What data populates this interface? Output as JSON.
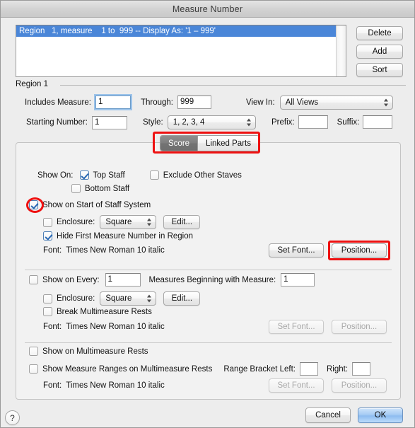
{
  "window": {
    "title": "Measure Number"
  },
  "region_list": {
    "items": [
      "Region   1, measure    1 to  999 -- Display As: '1 – 999'"
    ],
    "buttons": {
      "delete": "Delete",
      "add": "Add",
      "sort": "Sort"
    }
  },
  "region_section": {
    "label": "Region 1",
    "includes_measure_label": "Includes Measure:",
    "includes_measure_value": "1",
    "through_label": "Through:",
    "through_value": "999",
    "view_in_label": "View In:",
    "view_in_value": "All Views",
    "starting_number_label": "Starting Number:",
    "starting_number_value": "1",
    "style_label": "Style:",
    "style_value": "1, 2, 3, 4",
    "prefix_label": "Prefix:",
    "prefix_value": "",
    "suffix_label": "Suffix:",
    "suffix_value": ""
  },
  "tabs": [
    {
      "label": "Score",
      "active": true
    },
    {
      "label": "Linked Parts",
      "active": false
    }
  ],
  "show_on": {
    "label": "Show On:",
    "top_staff": {
      "label": "Top Staff",
      "checked": true
    },
    "exclude_other_staves": {
      "label": "Exclude Other Staves",
      "checked": false
    },
    "bottom_staff": {
      "label": "Bottom Staff",
      "checked": false
    }
  },
  "start_of_system": {
    "title": {
      "label": "Show on Start of Staff System",
      "checked": true
    },
    "enclosure": {
      "label": "Enclosure:",
      "checked": false,
      "value": "Square",
      "edit_label": "Edit..."
    },
    "hide_first": {
      "label": "Hide First Measure Number in Region",
      "checked": true
    },
    "font_label": "Font:",
    "font_value": "Times New Roman 10 italic",
    "set_font_label": "Set Font...",
    "position_label": "Position...",
    "buttons_enabled": true
  },
  "show_on_every": {
    "title": {
      "label": "Show on Every:",
      "checked": false
    },
    "every_value": "1",
    "measures_beginning_label": "Measures Beginning with Measure:",
    "measures_beginning_value": "1",
    "enclosure": {
      "label": "Enclosure:",
      "checked": false,
      "value": "Square",
      "edit_label": "Edit..."
    },
    "break_multimeasure": {
      "label": "Break Multimeasure Rests",
      "checked": false
    },
    "font_label": "Font:",
    "font_value": "Times New Roman 10 italic",
    "set_font_label": "Set Font...",
    "position_label": "Position...",
    "buttons_enabled": false
  },
  "multimeasure": {
    "show_on_rests": {
      "label": "Show on Multimeasure Rests",
      "checked": false
    },
    "show_ranges": {
      "label": "Show Measure Ranges on Multimeasure Rests",
      "checked": false
    },
    "range_bracket_left_label": "Range Bracket Left:",
    "range_bracket_left_value": "",
    "range_bracket_right_label": "Right:",
    "range_bracket_right_value": "",
    "font_label": "Font:",
    "font_value": "Times New Roman 10 italic",
    "set_font_label": "Set Font...",
    "position_label": "Position...",
    "buttons_enabled": false
  },
  "footer": {
    "help_label": "?",
    "cancel_label": "Cancel",
    "ok_label": "OK"
  },
  "annotations": {
    "accent_color": "#ee1111",
    "highlight_color": "#4a86d8"
  }
}
